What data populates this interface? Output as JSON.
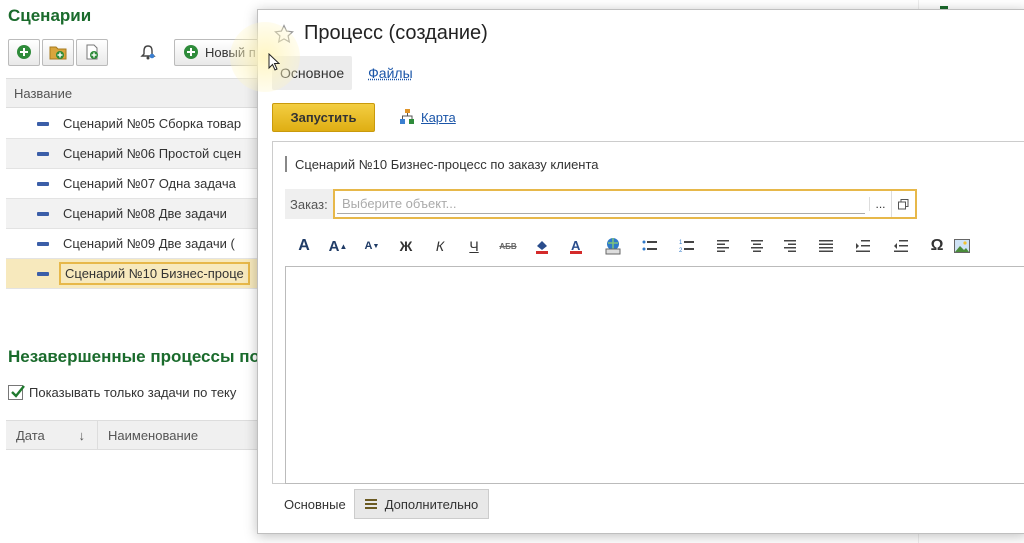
{
  "background": {
    "scenarios_title": "Сценарии",
    "new_button_label": "Новый п",
    "grid_header": "Название",
    "rows": [
      "Сценарий №05 Сборка товар",
      "Сценарий №06 Простой сцен",
      "Сценарий №07 Одна задача",
      "Сценарий №08 Две задачи",
      "Сценарий №09 Две задачи (",
      "Сценарий №10 Бизнес-проце"
    ],
    "selected_row_index": 5,
    "unfinished_title": "Незавершенные процессы по",
    "checkbox_label": "Показывать только задачи по теку",
    "checkbox_checked": true,
    "grid2_columns": [
      "Дата",
      "Наименование"
    ],
    "sort_arrow": "↓"
  },
  "dialog": {
    "title": "Процесс (создание)",
    "tabs": [
      "Основное",
      "Файлы"
    ],
    "start_button": "Запустить",
    "map_link": "Карта",
    "scenario_title": "Сценарий №10 Бизнес-процесс по заказу клиента",
    "order_label": "Заказ:",
    "order_placeholder": "Выберите объект...",
    "order_select_button": "...",
    "format_buttons": {
      "bold": "Ж",
      "italic": "К",
      "underline": "Ч",
      "strike": "АБВ",
      "special_char": "Ω"
    },
    "bottom_tabs": [
      "Основные",
      "Дополнительно"
    ]
  },
  "colors": {
    "green_title": "#1a6b2c",
    "link_blue": "#1a55a8",
    "accent_yellow": "#e7b84a",
    "start_button": "#dfae13"
  },
  "icons": [
    "add-icon",
    "add-folder-icon",
    "copy-icon",
    "bell-icon",
    "star-icon",
    "map-icon",
    "open-window-icon",
    "checkmark-icon"
  ]
}
